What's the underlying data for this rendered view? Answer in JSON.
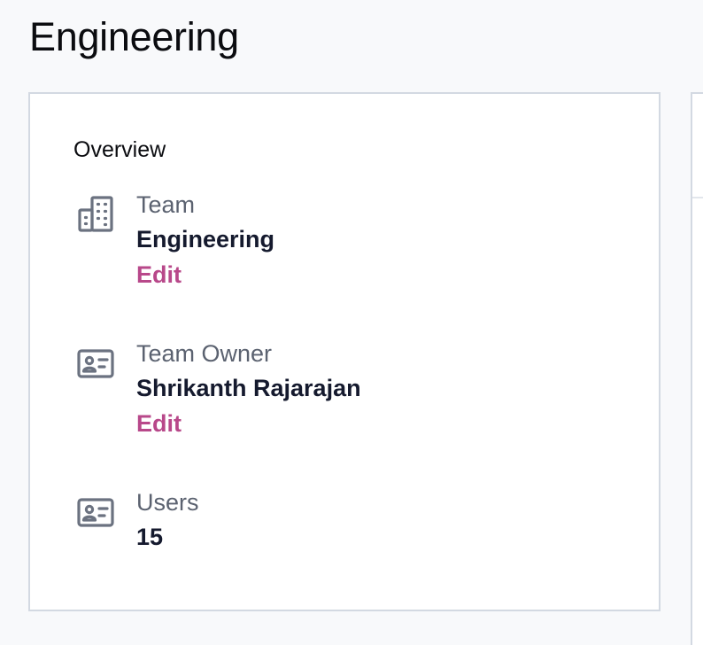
{
  "page": {
    "title": "Engineering"
  },
  "overview": {
    "heading": "Overview",
    "team": {
      "label": "Team",
      "value": "Engineering",
      "action": "Edit",
      "icon": "building-icon"
    },
    "owner": {
      "label": "Team Owner",
      "value": "Shrikanth Rajarajan",
      "action": "Edit",
      "icon": "id-card-icon"
    },
    "users": {
      "label": "Users",
      "value": "15",
      "icon": "id-card-icon"
    }
  },
  "colors": {
    "accent_link": "#b8488a",
    "value_text": "#151a2e",
    "label_text": "#5b6270",
    "icon": "#6b7280",
    "card_border": "#d3d9e2",
    "page_background": "#f8f9fb"
  }
}
